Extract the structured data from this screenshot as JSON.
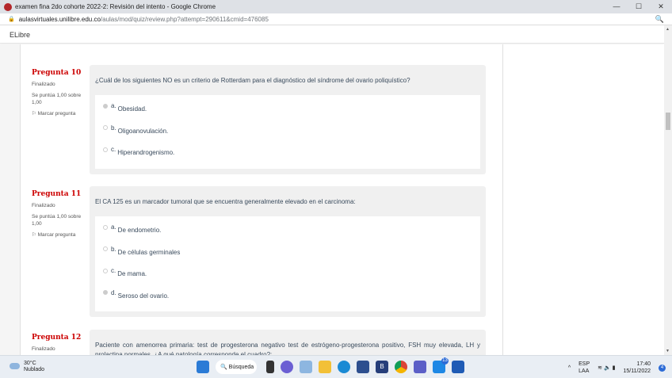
{
  "window": {
    "title": "examen fina 2do cohorte 2022-2: Revisión del intento - Google Chrome"
  },
  "address": {
    "host": "aulasvirtuales.unilibre.edu.co",
    "path": "/aulas/mod/quiz/review.php?attempt=290611&cmid=476085"
  },
  "site": {
    "name": "ELibre"
  },
  "questions": [
    {
      "number": "Pregunta 10",
      "status": "Finalizado",
      "score": "Se puntúa 1,00 sobre 1,00",
      "flag": "Marcar pregunta",
      "text": "¿Cuál de los siguientes NO es un criterio de Rotterdam para el diagnóstico del síndrome del ovario poliquístico?",
      "answers": [
        {
          "letter": "a.",
          "text": "Obesidad.",
          "selected": true
        },
        {
          "letter": "b.",
          "text": "Oligoanovulación.",
          "selected": false
        },
        {
          "letter": "c.",
          "text": "Hiperandrogenismo.",
          "selected": false
        }
      ]
    },
    {
      "number": "Pregunta 11",
      "status": "Finalizado",
      "score": "Se puntúa 1,00 sobre 1,00",
      "flag": "Marcar pregunta",
      "text": "El CA 125 es un marcador tumoral que se encuentra generalmente elevado en el carcinoma:",
      "answers": [
        {
          "letter": "a.",
          "text": "De endometrio.",
          "selected": false
        },
        {
          "letter": "b.",
          "text": "De células germinales",
          "selected": false
        },
        {
          "letter": "c.",
          "text": " De mama.",
          "selected": false
        },
        {
          "letter": "d.",
          "text": "Seroso del ovario.",
          "selected": true
        }
      ]
    },
    {
      "number": "Pregunta 12",
      "status": "Finalizado",
      "text": "Paciente con amenorrea primaria: test de progesterona negativo test de estrógeno-progesterona positivo, FSH muy elevada, LH y prolactina normales. ¿A qué patología corresponde el cuadro?:"
    }
  ],
  "taskbar": {
    "temp": "30°C",
    "weather": "Nublado",
    "search": "Búsqueda",
    "lang1": "ESP",
    "lang2": "LAA",
    "time": "17:40",
    "date": "15/11/2022",
    "notif": "4",
    "mail_badge": "13"
  }
}
